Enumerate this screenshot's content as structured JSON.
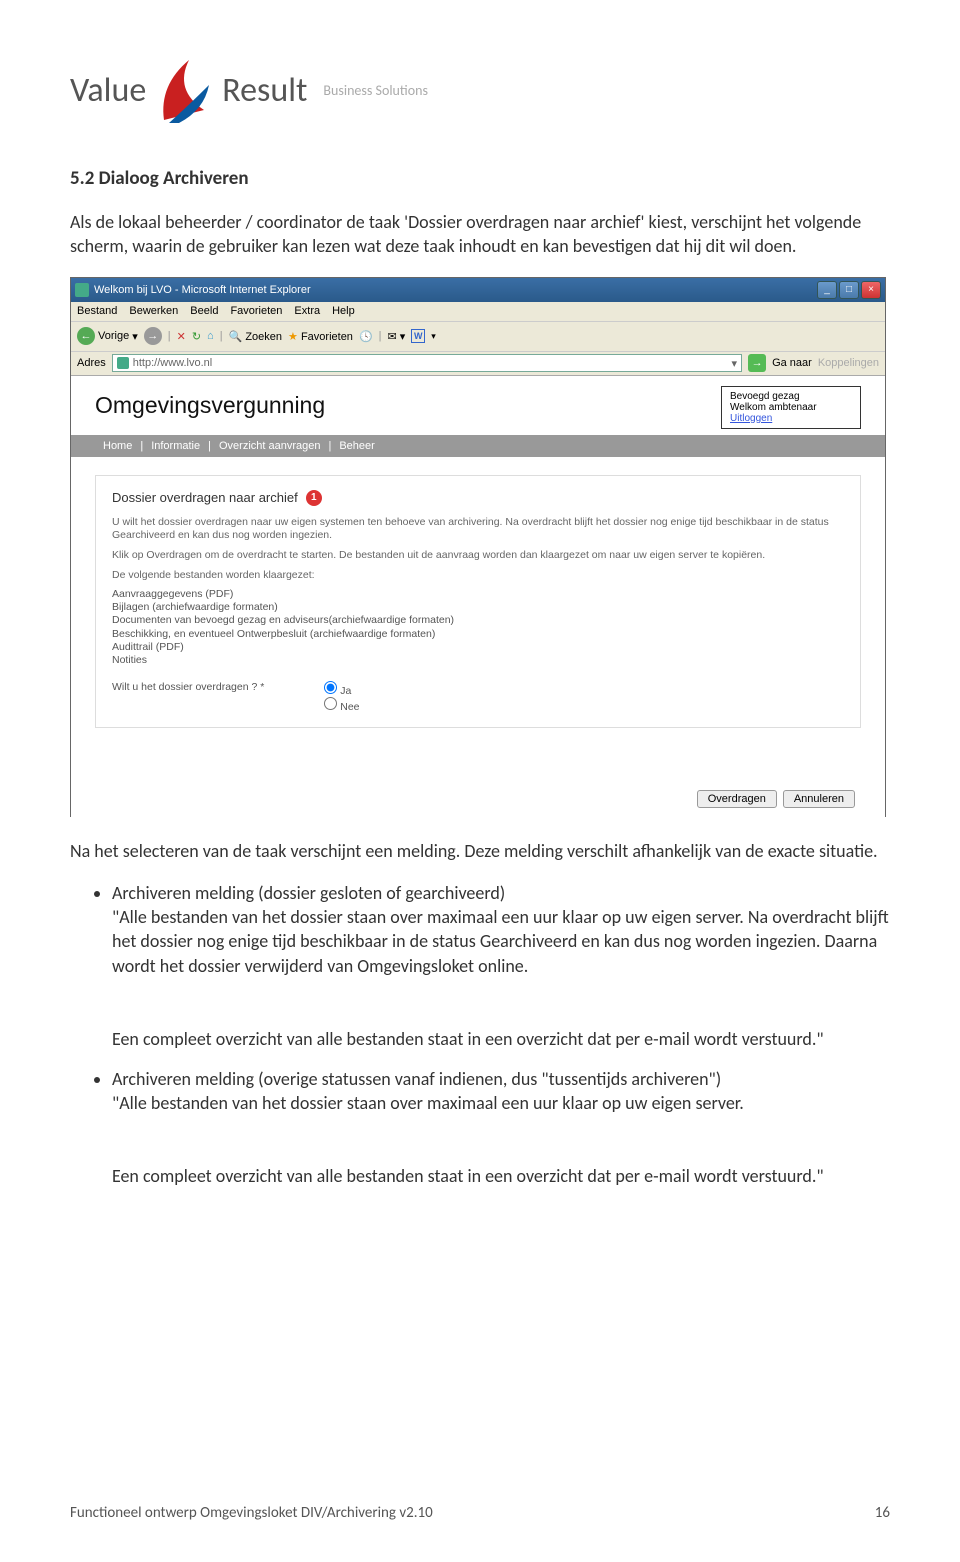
{
  "logo": {
    "brand1": "Value",
    "brand2": "Result",
    "tag": "Business Solutions"
  },
  "doc": {
    "heading": "5.2 Dialoog Archiveren",
    "intro": "Als de lokaal beheerder / coordinator de taak 'Dossier overdragen naar archief' kiest, verschijnt het volgende scherm, waarin de gebruiker kan lezen wat deze taak inhoudt en kan bevestigen dat hij dit wil doen.",
    "after": "Na het selecteren van de taak verschijnt een melding. Deze melding verschilt afhankelijk van de exacte situatie.",
    "b1_title": "Archiveren melding (dossier gesloten of gearchiveerd)",
    "b1_body": "\"Alle bestanden van het dossier staan over maximaal een uur klaar op uw eigen server. Na overdracht blijft het dossier nog enige tijd beschikbaar in de status Gearchiveerd en kan dus nog worden ingezien. Daarna wordt het dossier verwijderd van Omgevingsloket online.",
    "b1_tail": "Een compleet overzicht van alle bestanden staat in een overzicht dat per e-mail wordt verstuurd.\"",
    "b2_title": "Archiveren melding  (overige statussen vanaf indienen, dus  \"tussentijds archiveren\")",
    "b2_body": "\"Alle bestanden van het dossier staan over maximaal een uur klaar op uw eigen server.",
    "b2_tail": "Een compleet overzicht van alle bestanden staat in een overzicht dat per e-mail wordt verstuurd.\""
  },
  "ie": {
    "title": "Welkom bij LVO - Microsoft Internet Explorer",
    "menu": {
      "bestand": "Bestand",
      "bewerken": "Bewerken",
      "beeld": "Beeld",
      "favorieten": "Favorieten",
      "extra": "Extra",
      "help": "Help"
    },
    "toolbar": {
      "vorige": "Vorige",
      "zoeken": "Zoeken",
      "favorieten": "Favorieten"
    },
    "adres_label": "Adres",
    "url": "http://www.lvo.nl",
    "ganaar": "Ga naar",
    "koppelingen": "Koppelingen"
  },
  "app": {
    "title": "Omgevingsvergunning",
    "user": {
      "l1": "Bevoegd gezag",
      "l2": "Welkom ambtenaar",
      "l3": "Uitloggen"
    },
    "nav": {
      "home": "Home",
      "informatie": "Informatie",
      "overzicht": "Overzicht aanvragen",
      "beheer": "Beheer"
    },
    "panel": {
      "title": "Dossier overdragen naar archief",
      "p1": "U wilt het dossier overdragen naar uw eigen systemen ten behoeve van archivering. Na overdracht blijft het dossier nog enige tijd beschikbaar in de status Gearchiveerd en kan dus nog worden ingezien.",
      "p2": "Klik op Overdragen om de overdracht te starten. De bestanden uit de aanvraag worden dan klaargezet om naar uw eigen server te kopiëren.",
      "p3": "De volgende bestanden worden klaargezet:",
      "files": {
        "f1": "Aanvraaggegevens (PDF)",
        "f2": "Bijlagen (archiefwaardige formaten)",
        "f3": "Documenten van bevoegd gezag en adviseurs(archiefwaardige formaten)",
        "f4": "Beschikking, en eventueel Ontwerpbesluit (archiefwaardige formaten)",
        "f5": "Audittrail (PDF)",
        "f6": "Notities"
      },
      "q": "Wilt u het dossier overdragen ? *",
      "ja": "Ja",
      "nee": "Nee",
      "overdragen": "Overdragen",
      "annuleren": "Annuleren"
    }
  },
  "footer": {
    "left": "Functioneel ontwerp Omgevingsloket DIV/Archivering v2.10",
    "right": "16"
  }
}
